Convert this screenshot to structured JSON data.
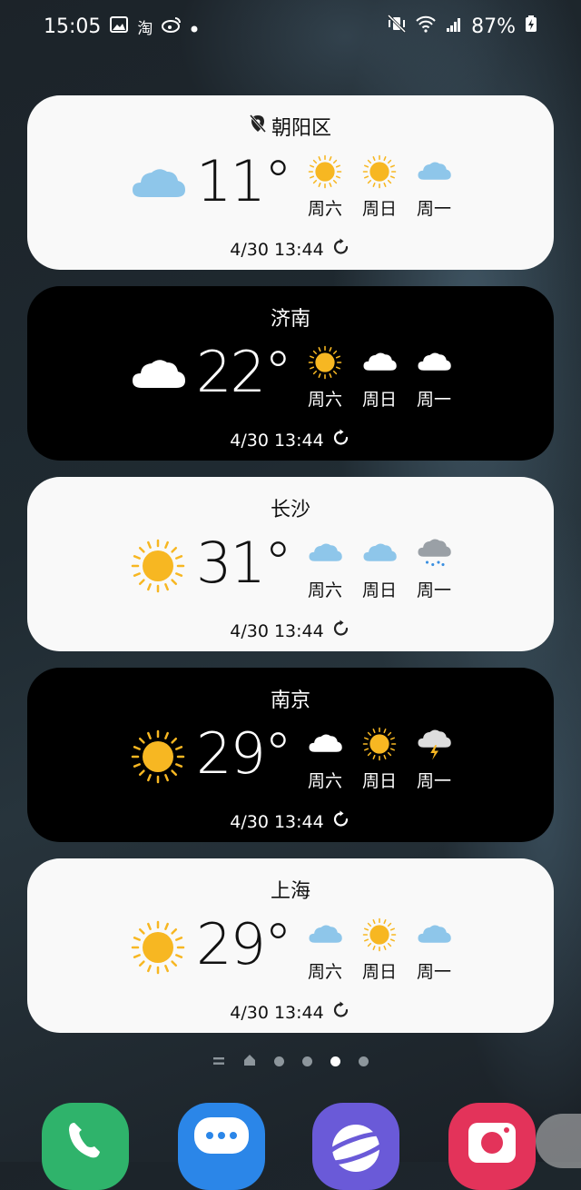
{
  "status_bar": {
    "time": "15:05",
    "icons_left": [
      "gallery-icon",
      "taobao-icon",
      "weibo-icon",
      "notification-dot-icon"
    ],
    "taobao_label": "淘",
    "icons_right": [
      "mute-vibrate-icon",
      "wifi-icon",
      "signal-icon",
      "battery-charging-icon"
    ],
    "battery": "87%"
  },
  "cards": [
    {
      "city": "朝阳区",
      "theme": "light",
      "location_pin": true,
      "current": "cloudy",
      "temp": "11°",
      "forecast": [
        {
          "day": "周六",
          "icon": "sunny"
        },
        {
          "day": "周日",
          "icon": "sunny"
        },
        {
          "day": "周一",
          "icon": "cloudy"
        }
      ],
      "updated": "4/30 13:44"
    },
    {
      "city": "济南",
      "theme": "dark",
      "location_pin": false,
      "current": "cloudy",
      "temp": "22°",
      "forecast": [
        {
          "day": "周六",
          "icon": "sunny"
        },
        {
          "day": "周日",
          "icon": "cloudy"
        },
        {
          "day": "周一",
          "icon": "cloudy"
        }
      ],
      "updated": "4/30 13:44"
    },
    {
      "city": "长沙",
      "theme": "light",
      "location_pin": false,
      "current": "sunny",
      "temp": "31°",
      "forecast": [
        {
          "day": "周六",
          "icon": "cloudy"
        },
        {
          "day": "周日",
          "icon": "cloudy"
        },
        {
          "day": "周一",
          "icon": "rain"
        }
      ],
      "updated": "4/30 13:44"
    },
    {
      "city": "南京",
      "theme": "dark",
      "location_pin": false,
      "current": "sunny",
      "temp": "29°",
      "forecast": [
        {
          "day": "周六",
          "icon": "cloudy"
        },
        {
          "day": "周日",
          "icon": "sunny"
        },
        {
          "day": "周一",
          "icon": "thunderstorm"
        }
      ],
      "updated": "4/30 13:44"
    },
    {
      "city": "上海",
      "theme": "light",
      "location_pin": false,
      "current": "sunny",
      "temp": "29°",
      "forecast": [
        {
          "day": "周六",
          "icon": "cloudy"
        },
        {
          "day": "周日",
          "icon": "sunny"
        },
        {
          "day": "周一",
          "icon": "cloudy"
        }
      ],
      "updated": "4/30 13:44"
    }
  ],
  "pager": {
    "items": [
      "home-list-icon",
      "home-icon",
      "dot",
      "dot",
      "dot",
      "dot"
    ],
    "active_index": 4
  },
  "dock": [
    {
      "name": "phone-app-icon",
      "color": "#2fb36b"
    },
    {
      "name": "messages-app-icon",
      "color": "#2b86e8"
    },
    {
      "name": "internet-app-icon",
      "color": "#6a5ad8"
    },
    {
      "name": "camera-app-icon",
      "color": "#e3335a"
    }
  ],
  "colors": {
    "sun": "#f7b722",
    "cloud_light_card": "#8ec6ea",
    "cloud_dark_card": "#ffffff",
    "rain_cloud": "#9aa0a6",
    "rain_drop": "#3a8fe0",
    "bolt": "#f7b722"
  }
}
